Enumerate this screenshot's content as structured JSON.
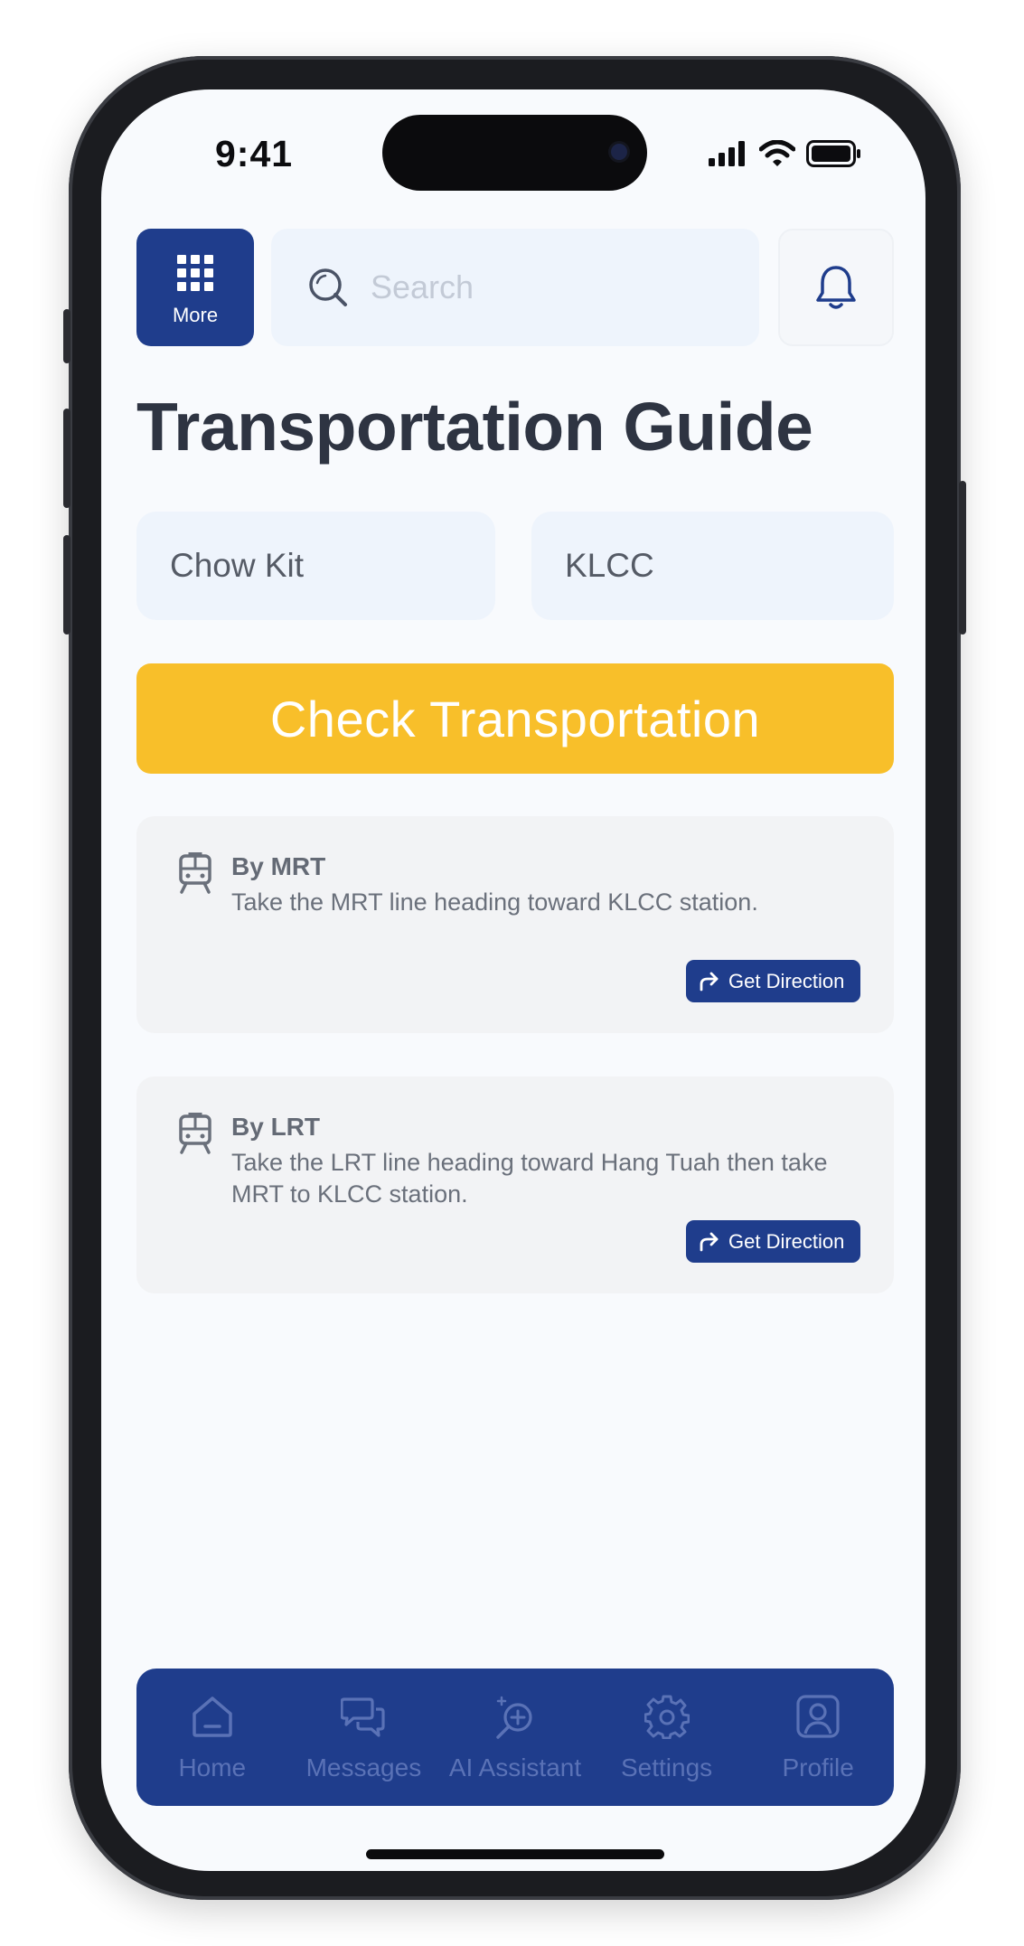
{
  "status_bar": {
    "time": "9:41"
  },
  "header": {
    "more_label": "More",
    "search_placeholder": "Search"
  },
  "page_title": "Transportation Guide",
  "locations": {
    "from": "Chow Kit",
    "to": "KLCC"
  },
  "check_button_label": "Check Transportation",
  "options": [
    {
      "title": "By MRT",
      "description": "Take the MRT line heading toward KLCC station.",
      "button_label": "Get Direction",
      "icon": "train-icon"
    },
    {
      "title": "By LRT",
      "description": "Take the LRT line heading toward Hang Tuah then take MRT to KLCC station.",
      "button_label": "Get Direction",
      "icon": "train-icon"
    }
  ],
  "bottom_nav": [
    {
      "label": "Home",
      "icon": "home-icon"
    },
    {
      "label": "Messages",
      "icon": "messages-icon"
    },
    {
      "label": "AI Assistant",
      "icon": "ai-assistant-icon"
    },
    {
      "label": "Settings",
      "icon": "gear-icon"
    },
    {
      "label": "Profile",
      "icon": "profile-icon"
    }
  ],
  "colors": {
    "primary": "#1f3d8c",
    "accent": "#f8bf2a",
    "field_bg": "#eef4fc",
    "card_bg": "#f2f3f5"
  }
}
